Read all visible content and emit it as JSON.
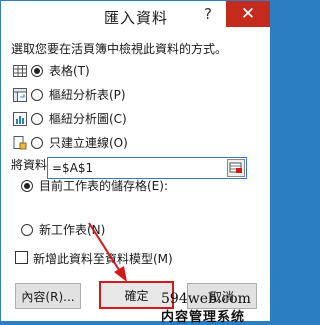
{
  "window": {
    "title": "匯入資料",
    "help_glyph": "?",
    "close_glyph": "✕"
  },
  "prompt": "選取您要在活頁簿中檢視此資料的方式。",
  "view_options": [
    {
      "label": "表格(T)",
      "selected": true,
      "icon": "table-icon"
    },
    {
      "label": "樞紐分析表(P)",
      "selected": false,
      "icon": "pivottable-icon"
    },
    {
      "label": "樞紐分析圖(C)",
      "selected": false,
      "icon": "pivotchart-icon"
    },
    {
      "label": "只建立連線(O)",
      "selected": false,
      "icon": "connection-icon"
    }
  ],
  "placement_label": "將資料放在",
  "placement_options": [
    {
      "label": "目前工作表的儲存格(E):",
      "selected": true
    },
    {
      "label": "新工作表(N)",
      "selected": false
    }
  ],
  "cell_reference": "=$A$1",
  "data_model_checkbox": {
    "label": "新增此資料至資料模型(M)",
    "checked": false
  },
  "buttons": {
    "properties": "內容(R)...",
    "ok": "確定",
    "cancel": "取消"
  },
  "watermark": {
    "line1": "594web.com",
    "line2": "内容管理系统"
  },
  "colors": {
    "highlight": "#d21a1a",
    "accent": "#2b7fc0"
  }
}
